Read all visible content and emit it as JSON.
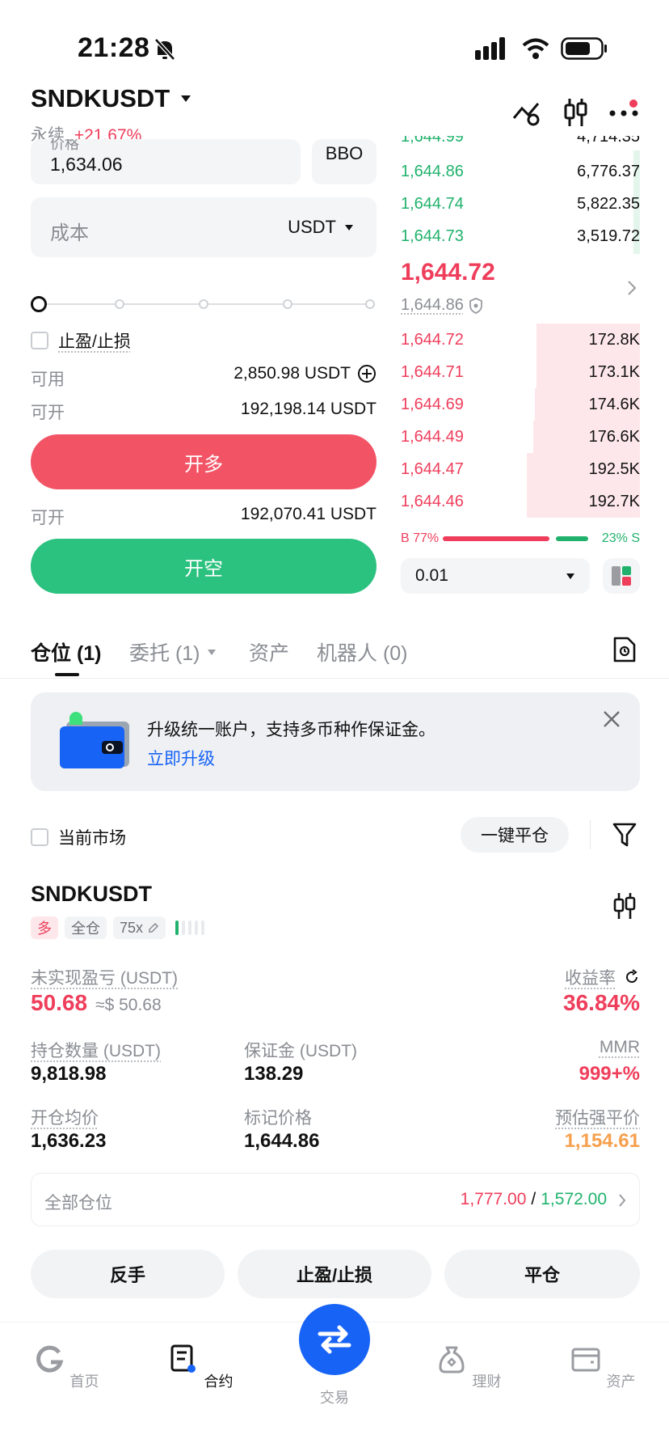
{
  "status_bar": {
    "time": "21:28"
  },
  "header": {
    "pair": "SNDKUSDT",
    "perp_label": "永续",
    "change": "+21.67%"
  },
  "order_form": {
    "price_label_partial": "价格",
    "price_value": "1,634.06",
    "bbo_label": "BBO",
    "cost_placeholder": "成本",
    "cost_unit": "USDT",
    "tpsl_label": "止盈/止损",
    "available_label": "可用",
    "available_value": "2,850.98 USDT",
    "can_open_label": "可开",
    "can_open_long_value": "192,198.14 USDT",
    "long_button": "开多",
    "can_open_short_value": "192,070.41 USDT",
    "short_button": "开空"
  },
  "order_book": {
    "bids_top": [
      {
        "price": "1,644.86",
        "qty": "6,776.37"
      },
      {
        "price": "1,644.74",
        "qty": "5,822.35"
      },
      {
        "price": "1,644.73",
        "qty": "3,519.72"
      }
    ],
    "last_price": "1,644.72",
    "mark_price": "1,644.86",
    "asks": [
      {
        "price": "1,644.72",
        "qty": "172.8K"
      },
      {
        "price": "1,644.71",
        "qty": "173.1K"
      },
      {
        "price": "1,644.69",
        "qty": "174.6K"
      },
      {
        "price": "1,644.49",
        "qty": "176.6K"
      },
      {
        "price": "1,644.47",
        "qty": "192.5K"
      },
      {
        "price": "1,644.46",
        "qty": "192.7K"
      }
    ],
    "buy_ratio_label": "B 77%",
    "sell_ratio_label": "23% S",
    "buy_ratio": 0.77,
    "precision": "0.01"
  },
  "tabs": {
    "positions": "仓位 (1)",
    "orders": "委托 (1)",
    "assets": "资产",
    "bots": "机器人 (0)"
  },
  "banner": {
    "text": "升级统一账户，支持多币种作保证金。",
    "link": "立即升级"
  },
  "filters": {
    "current_market": "当前市场",
    "close_all": "一键平仓"
  },
  "position": {
    "symbol": "SNDKUSDT",
    "side_tag": "多",
    "margin_tag": "全仓",
    "leverage_tag": "75x",
    "unrealized_label": "未实现盈亏 (USDT)",
    "unrealized_value": "50.68",
    "unrealized_usd": "≈$ 50.68",
    "roe_label": "收益率",
    "roe_value": "36.84%",
    "size_label": "持仓数量 (USDT)",
    "size_value": "9,818.98",
    "margin_label": "保证金 (USDT)",
    "margin_value": "138.29",
    "mmr_label": "MMR",
    "mmr_value": "999+%",
    "entry_label": "开仓均价",
    "entry_value": "1,636.23",
    "mark_label": "标记价格",
    "mark_value": "1,644.86",
    "liq_label": "预估强平价",
    "liq_value": "1,154.61",
    "all_positions_label": "全部仓位",
    "all_tp": "1,777.00",
    "all_sl": "1,572.00",
    "btn_reverse": "反手",
    "btn_tpsl": "止盈/止损",
    "btn_close": "平仓"
  },
  "bottom_nav": {
    "home": "首页",
    "contract": "合约",
    "trade": "交易",
    "earn": "理财",
    "assets": "资产"
  },
  "colors": {
    "red": "#ef3e5b",
    "green": "#20b26c",
    "blue": "#1763f6",
    "orange": "#f6a04d"
  }
}
